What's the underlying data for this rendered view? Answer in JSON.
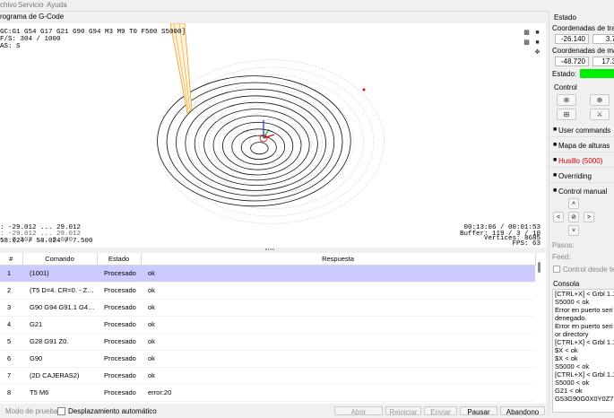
{
  "menu": [
    "chivo",
    "Servicio",
    "Ayuda"
  ],
  "gcode_title": "rograma de G-Code",
  "viewport": {
    "status_line1": "GC:G1 G54 G17 G21 G90 G94 M3 M9 T0 F500 S5000]",
    "status_line2": "F/S: 304 / 1000",
    "status_line3": "AS: S",
    "bounds_line1": ": -29.012 ... 29.012",
    "bounds_line2": ": -29.012 ... 29.012",
    "bounds_line3": ": -7.500 ... 0.000",
    "bounds_line4": "58.024 / 58.024 / 7.500",
    "time": "00:13:06 / 00:01:53",
    "buffer": "Buffer: 119 / 3 / 10",
    "vertices": "Vertices: 8685",
    "fps": "FPS: 63"
  },
  "table": {
    "headers": [
      "#",
      "Comando",
      "Estado",
      "Respuesta"
    ],
    "rows": [
      {
        "n": "1",
        "cmd": "(1001)",
        "state": "Procesado",
        "resp": "ok"
      },
      {
        "n": "2",
        "cmd": "(T5 D=4. CR=0. - ZMIN=...",
        "state": "Procesado",
        "resp": "ok"
      },
      {
        "n": "3",
        "cmd": "G90 G94 G91.1 G40 G49 G17",
        "state": "Procesado",
        "resp": "ok"
      },
      {
        "n": "4",
        "cmd": "G21",
        "state": "Procesado",
        "resp": "ok"
      },
      {
        "n": "5",
        "cmd": "G28 G91 Z0.",
        "state": "Procesado",
        "resp": "ok"
      },
      {
        "n": "6",
        "cmd": "G90",
        "state": "Procesado",
        "resp": "ok"
      },
      {
        "n": "7",
        "cmd": "(2D CAJERAS2)",
        "state": "Procesado",
        "resp": "ok"
      },
      {
        "n": "8",
        "cmd": "T5 M6",
        "state": "Procesado",
        "resp": "error:20"
      }
    ]
  },
  "bottom": {
    "test_mode": "Modo de prueba",
    "autoscroll": "Desplazamiento automático",
    "open": "Abrir",
    "reset": "Reiniciar",
    "send": "Enviar",
    "pause": "Pausar",
    "abort": "Abandono"
  },
  "right": {
    "estado": "Estado",
    "work_coords": "Coordenadas de trab",
    "work_x": "-26.140",
    "work_y": "3.7",
    "machine_coords": "Coordenadas de máq",
    "machine_x": "-48.720",
    "machine_y": "17.3",
    "estado_label": "Estado:",
    "status_color": "#00ee00",
    "control": "Control",
    "user_commands": "User commands",
    "height_map": "Mapa de alturas",
    "spindle": "Husillo (5000)",
    "spindle_color": "#cc0000",
    "overriding": "Overriding",
    "manual": "Control manual",
    "pasos": "Pasos:",
    "feed": "Feed:",
    "control_desde": "Control desde tec",
    "consola": "Consola",
    "console_lines": [
      "[CTRL+X] < Grbl 1.1",
      "S5000 < ok",
      "Error en puerto seri",
      "denegado.",
      "Error en puerto seri",
      "or directory",
      "[CTRL+X] < Grbl 1.1",
      "$X < ok",
      "$X < ok",
      "S5000 < ok",
      "[CTRL+X] < Grbl 1.1",
      "S5000 < ok",
      "G21 < ok",
      "G53G90G0X0Y0Z7.1"
    ]
  }
}
